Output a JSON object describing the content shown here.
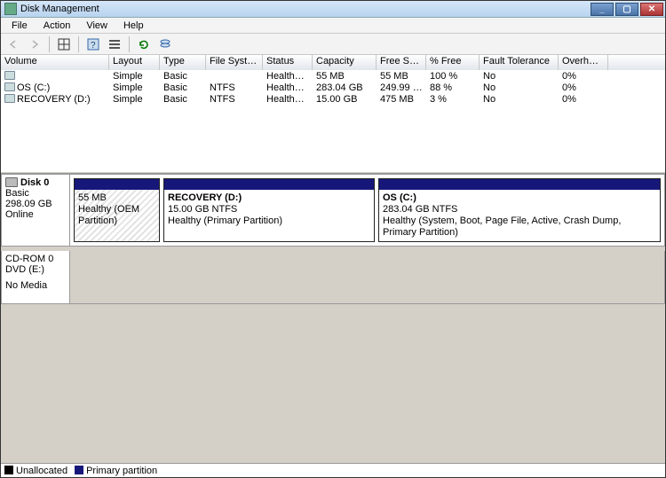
{
  "window": {
    "title": "Disk Management"
  },
  "menu": {
    "file": "File",
    "action": "Action",
    "view": "View",
    "help": "Help"
  },
  "columns": {
    "volume": "Volume",
    "layout": "Layout",
    "type": "Type",
    "fs": "File System",
    "status": "Status",
    "capacity": "Capacity",
    "free": "Free Spa...",
    "pctfree": "% Free",
    "ft": "Fault Tolerance",
    "overhead": "Overhead"
  },
  "volumes": [
    {
      "name": "",
      "layout": "Simple",
      "type": "Basic",
      "fs": "",
      "status": "Healthy (...",
      "capacity": "55 MB",
      "free": "55 MB",
      "pctfree": "100 %",
      "ft": "No",
      "overhead": "0%"
    },
    {
      "name": "OS (C:)",
      "layout": "Simple",
      "type": "Basic",
      "fs": "NTFS",
      "status": "Healthy (S...",
      "capacity": "283.04 GB",
      "free": "249.99 GB",
      "pctfree": "88 %",
      "ft": "No",
      "overhead": "0%"
    },
    {
      "name": "RECOVERY (D:)",
      "layout": "Simple",
      "type": "Basic",
      "fs": "NTFS",
      "status": "Healthy (P...",
      "capacity": "15.00 GB",
      "free": "475 MB",
      "pctfree": "3 %",
      "ft": "No",
      "overhead": "0%"
    }
  ],
  "disk0": {
    "title": "Disk 0",
    "type": "Basic",
    "size": "298.09 GB",
    "state": "Online",
    "p0": {
      "line1": "55 MB",
      "line2": "Healthy (OEM Partition)"
    },
    "p1": {
      "title": "RECOVERY  (D:)",
      "line1": "15.00 GB NTFS",
      "line2": "Healthy (Primary Partition)"
    },
    "p2": {
      "title": "OS  (C:)",
      "line1": "283.04 GB NTFS",
      "line2": "Healthy (System, Boot, Page File, Active, Crash Dump, Primary Partition)"
    }
  },
  "cdrom": {
    "title": "CD-ROM 0",
    "sub": "DVD (E:)",
    "state": "No Media"
  },
  "legend": {
    "unallocated": "Unallocated",
    "primary": "Primary partition"
  }
}
